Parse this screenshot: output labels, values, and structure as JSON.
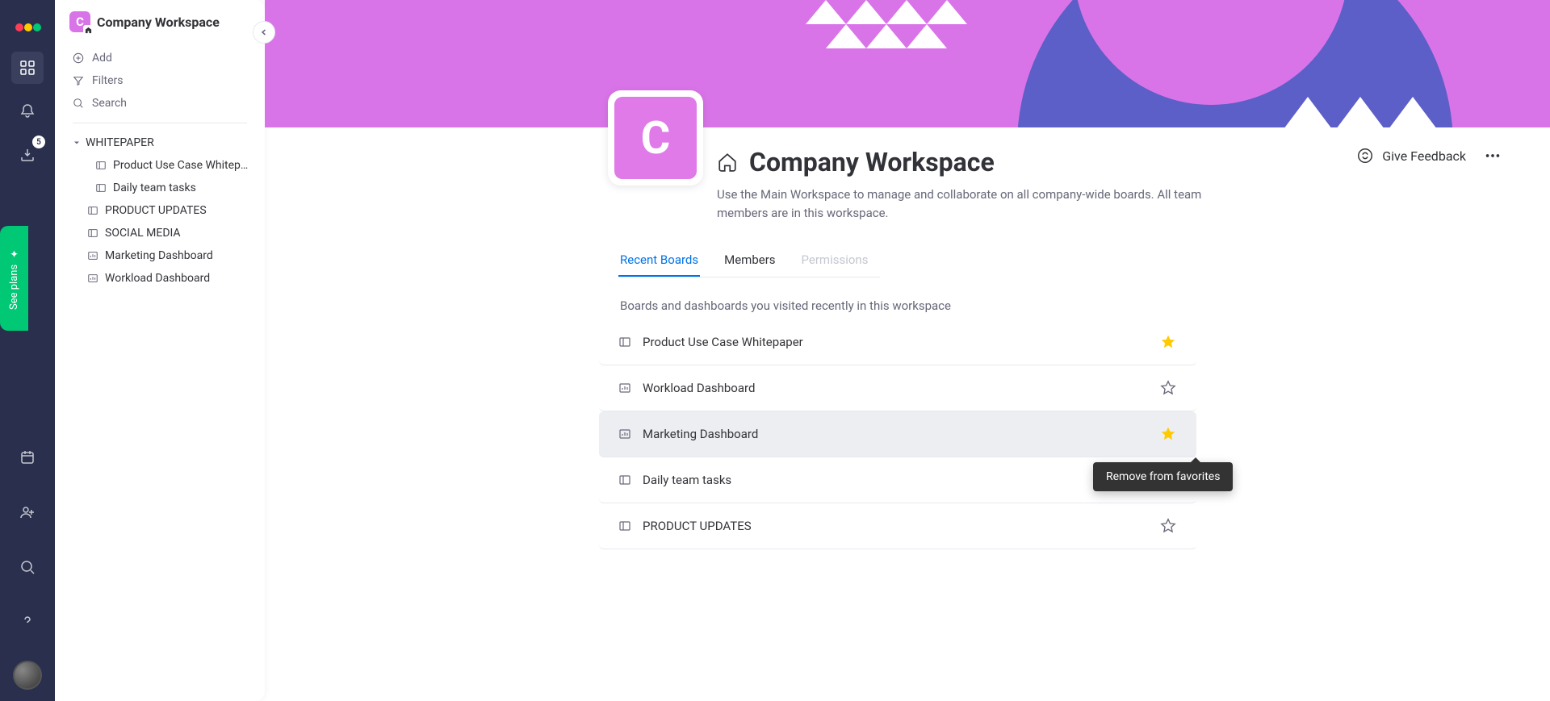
{
  "rail": {
    "download_badge": "5",
    "see_plans": "See plans"
  },
  "sidebar": {
    "workspace_letter": "C",
    "workspace_name": "Company Workspace",
    "add": "Add",
    "filters": "Filters",
    "search": "Search",
    "tree": {
      "folder1": "WHITEPAPER",
      "item1": "Product Use Case Whitep…",
      "item2": "Daily team tasks",
      "item3": "PRODUCT UPDATES",
      "item4": "SOCIAL MEDIA",
      "item5": "Marketing Dashboard",
      "item6": "Workload Dashboard"
    }
  },
  "workspace": {
    "letter": "C",
    "title": "Company Workspace",
    "description": "Use the Main Workspace to manage and collaborate on all company-wide boards. All team members are in this workspace.",
    "feedback": "Give Feedback"
  },
  "tabs": {
    "recent": "Recent Boards",
    "members": "Members",
    "permissions": "Permissions"
  },
  "recent": {
    "description": "Boards and dashboards you visited recently in this workspace",
    "rows": [
      {
        "label": "Product Use Case Whitepaper",
        "type": "board",
        "starred": true
      },
      {
        "label": "Workload Dashboard",
        "type": "dashboard",
        "starred": false
      },
      {
        "label": "Marketing Dashboard",
        "type": "dashboard",
        "starred": true
      },
      {
        "label": "Daily team tasks",
        "type": "board",
        "starred": false
      },
      {
        "label": "PRODUCT UPDATES",
        "type": "board",
        "starred": false
      }
    ]
  },
  "tooltip": "Remove from favorites",
  "colors": {
    "accent": "#0073ea",
    "brand_pink": "#d974e8",
    "brand_purple": "#5b5fc7",
    "star": "#ffcb00",
    "green": "#00c875"
  }
}
